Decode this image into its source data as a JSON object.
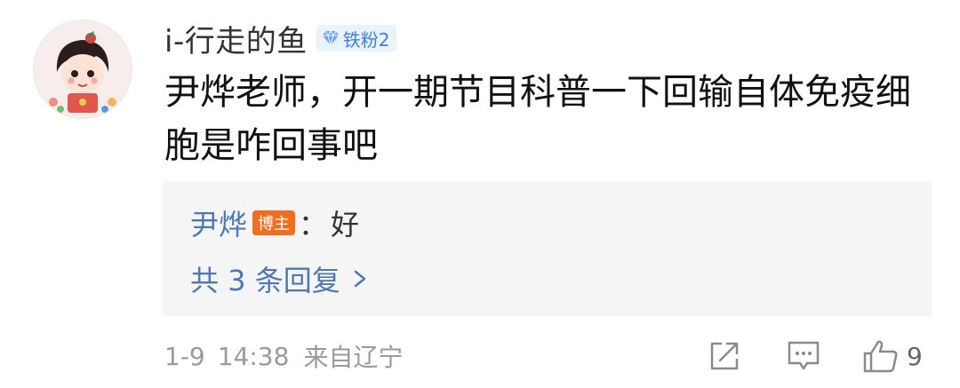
{
  "comment": {
    "username": "i-行走的鱼",
    "fan_badge": "铁粉2",
    "text": "尹烨老师，开一期节目科普一下回输自体免疫细胞是咋回事吧"
  },
  "reply": {
    "author": "尹烨",
    "author_badge": "博主",
    "colon": "：",
    "content": "好",
    "more_label": "共 3 条回复"
  },
  "meta": {
    "date": "1-9",
    "time": "14:38",
    "source": "来自辽宁"
  },
  "actions": {
    "like_count": "9"
  },
  "icons": {
    "fan_badge": "diamond-icon",
    "more": "chevron-right-icon",
    "share": "share-icon",
    "comment": "comment-icon",
    "like": "thumbs-up-icon"
  },
  "colors": {
    "link_blue": "#4e77b6",
    "badge_blue": "#3f7ee8",
    "blogger_orange": "#f36d21",
    "reply_background": "#f5f5f5",
    "meta_gray": "#9a9a9a"
  }
}
